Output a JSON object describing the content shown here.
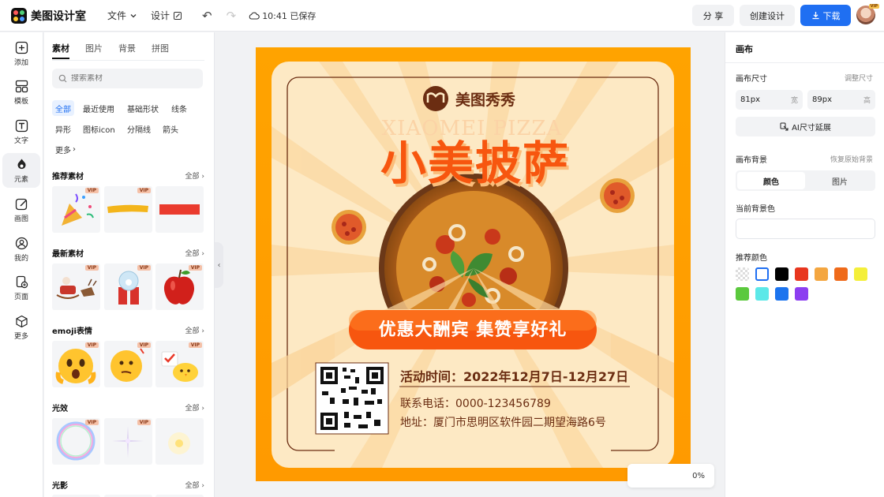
{
  "app": {
    "name": "美图设计室"
  },
  "topbar": {
    "file_menu": "文件",
    "design_menu": "设计",
    "save_status": "10:41 已保存",
    "share_label": "分 享",
    "create_label": "创建设计",
    "download_label": "下载"
  },
  "rail": {
    "items": [
      {
        "label": "添加",
        "icon": "plus-square-icon"
      },
      {
        "label": "模板",
        "icon": "template-icon"
      },
      {
        "label": "文字",
        "icon": "text-icon"
      },
      {
        "label": "元素",
        "icon": "shapes-icon"
      },
      {
        "label": "画图",
        "icon": "draw-icon"
      },
      {
        "label": "我的",
        "icon": "user-icon"
      },
      {
        "label": "页面",
        "icon": "page-icon"
      },
      {
        "label": "更多",
        "icon": "cube-icon"
      }
    ],
    "active": "元素"
  },
  "panel": {
    "tabs": [
      "素材",
      "图片",
      "背景",
      "拼图"
    ],
    "active_tab": "素材",
    "search_placeholder": "搜索素材",
    "chips": [
      "全部",
      "最近使用",
      "基础形状",
      "线条",
      "异形",
      "图标icon",
      "分隔线",
      "箭头",
      "更多"
    ],
    "sections": [
      {
        "title": "推荐素材",
        "all": "全部"
      },
      {
        "title": "最新素材",
        "all": "全部"
      },
      {
        "title": "emoji表情",
        "all": "全部"
      },
      {
        "title": "光效",
        "all": "全部"
      },
      {
        "title": "光影",
        "all": "全部"
      }
    ],
    "vip_badge": "VIP"
  },
  "poster": {
    "brand": "美图秀秀",
    "watermark": "XIAOMEI PIZZA",
    "title": "小美披萨",
    "banner": "优惠大酬宾 集赞享好礼",
    "event_time": "活动时间：2022年12月7日-12月27日",
    "phone": "联系电话：0000-123456789",
    "address": "地址：厦门市思明区软件园二期望海路6号",
    "colors": {
      "orange": "#ff9a00",
      "cream": "#fde9c4",
      "brown": "#6b2d12",
      "red_orange": "#f7560f"
    }
  },
  "right": {
    "title": "画布",
    "size_label": "画布尺寸",
    "size_hint": "调整尺寸",
    "width_value": "81px",
    "width_unit": "宽",
    "height_value": "89px",
    "height_unit": "高",
    "ai_button": "AI尺寸延展",
    "bg_label": "画布背景",
    "bg_hint": "恢复原始背景",
    "seg_color": "颜色",
    "seg_image": "图片",
    "current_bg": "当前背景色",
    "recommend": "推荐颜色",
    "swatches": [
      "transparent",
      "#ffffff",
      "#000000",
      "#e8361e",
      "#f4a640",
      "#ef6a1a",
      "#f4ef3a",
      "#5bc93d",
      "#5ce8e8",
      "#1c74ee",
      "#8c3ef0"
    ]
  },
  "zoom": {
    "value": "0%"
  }
}
